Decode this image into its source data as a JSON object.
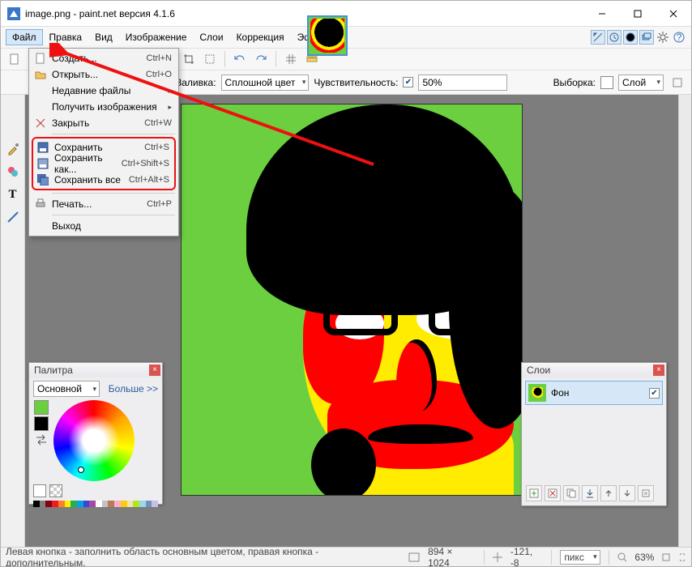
{
  "window": {
    "title": "image.png - paint.net версия 4.1.6"
  },
  "menubar": {
    "items": [
      "Файл",
      "Правка",
      "Вид",
      "Изображение",
      "Слои",
      "Коррекция",
      "Эффекты"
    ]
  },
  "helpicons": [
    "arrow",
    "windows",
    "palette",
    "layers",
    "gear",
    "help"
  ],
  "file_menu": {
    "create": {
      "label": "Создать...",
      "shortcut": "Ctrl+N"
    },
    "open": {
      "label": "Открыть...",
      "shortcut": "Ctrl+O"
    },
    "recent": {
      "label": "Недавние файлы"
    },
    "acquire": {
      "label": "Получить изображения"
    },
    "close": {
      "label": "Закрыть",
      "shortcut": "Ctrl+W"
    },
    "save": {
      "label": "Сохранить",
      "shortcut": "Ctrl+S"
    },
    "saveas": {
      "label": "Сохранить как...",
      "shortcut": "Ctrl+Shift+S"
    },
    "saveall": {
      "label": "Сохранить все",
      "shortcut": "Ctrl+Alt+S"
    },
    "print": {
      "label": "Печать...",
      "shortcut": "Ctrl+P"
    },
    "exit": {
      "label": "Выход"
    }
  },
  "options": {
    "fill_label": "Заливка:",
    "fill_value": "Сплошной цвет",
    "tolerance_label": "Чувствительность:",
    "tolerance_value": "50%",
    "sel_label": "Выборка:",
    "sel_value": "Слой"
  },
  "palette": {
    "title": "Палитра",
    "mode": "Основной",
    "more": "Больше >>",
    "primary": "#6bcf3f",
    "secondary": "#000000",
    "strip": [
      "#000000",
      "#7f7f7f",
      "#880015",
      "#ed1c24",
      "#ff7f27",
      "#fff200",
      "#22b14c",
      "#00a2e8",
      "#3f48cc",
      "#a349a4",
      "#ffffff",
      "#c3c3c3",
      "#b97a57",
      "#ffaec9",
      "#ffc90e",
      "#efe4b0",
      "#b5e61d",
      "#99d9ea",
      "#7092be",
      "#c8bfe7"
    ]
  },
  "layers": {
    "title": "Слои",
    "item": {
      "name": "Фон",
      "visible": true
    }
  },
  "status": {
    "hint": "Левая кнопка - заполнить область основным цветом, правая кнопка - дополнительным.",
    "size": "894 × 1024",
    "pos": "-121, -8",
    "unit": "пикс",
    "zoom": "63%"
  }
}
